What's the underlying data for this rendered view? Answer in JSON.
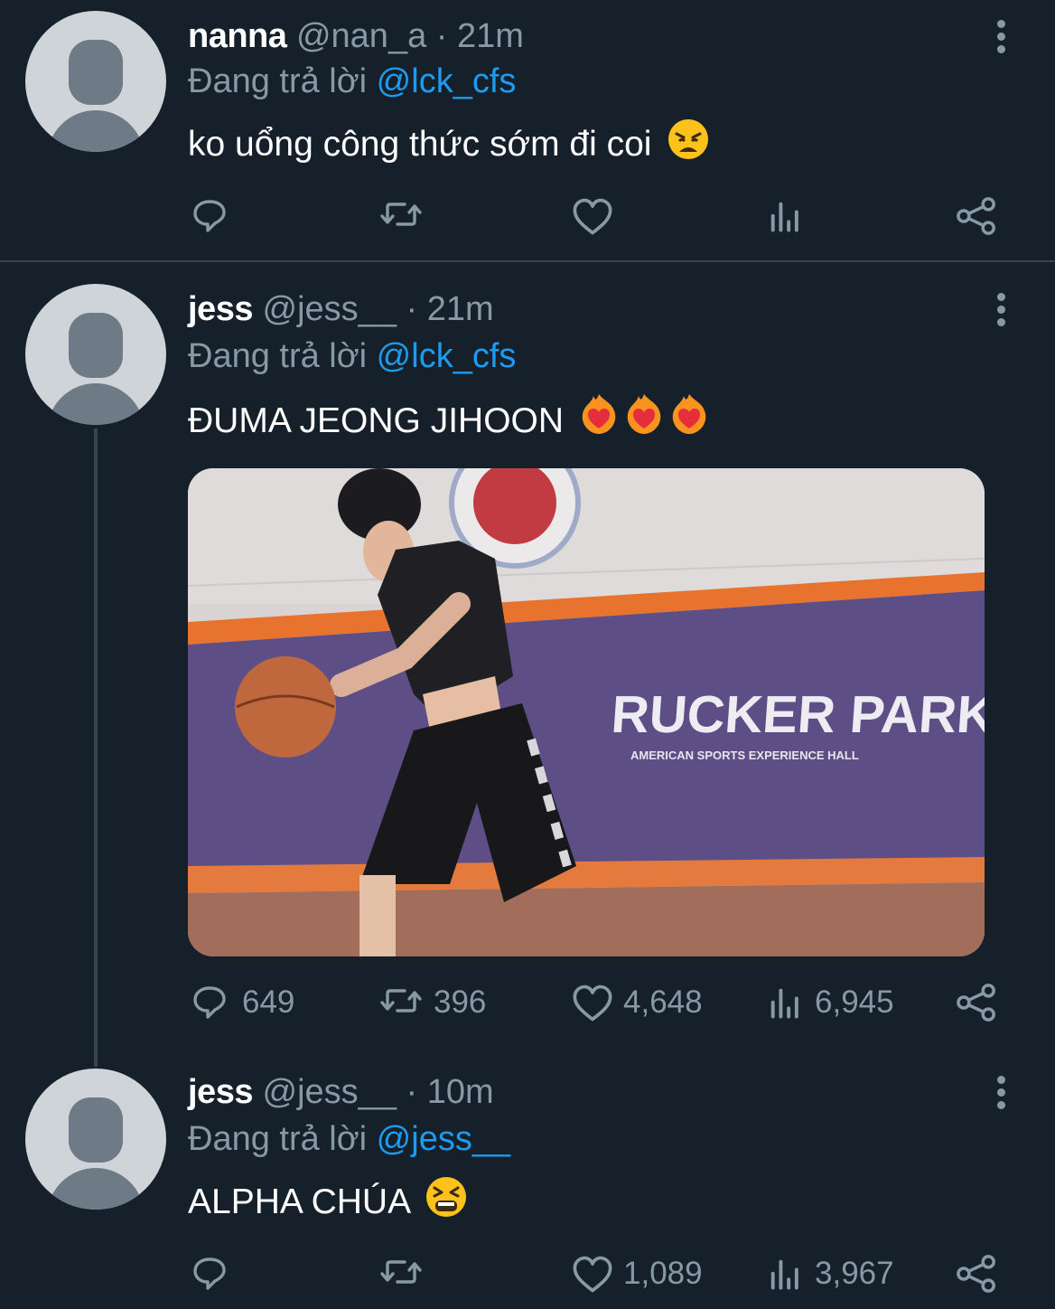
{
  "tweets": [
    {
      "name": "nanna",
      "handle": "@nan_a",
      "dot": "·",
      "time": "21m",
      "reply_prefix": "Đang trả lời",
      "reply_to": "@lck_cfs",
      "text": "ko uổng công thức sớm đi coi",
      "emoji": "weary-face-emoji",
      "stats": {
        "replies": "",
        "retweets": "",
        "likes": "",
        "views": ""
      }
    },
    {
      "name": "jess",
      "handle": "@jess__",
      "dot": "·",
      "time": "21m",
      "reply_prefix": "Đang trả lời",
      "reply_to": "@lck_cfs",
      "text": "ĐUMA JEONG JIHOON",
      "emoji": "heart-on-fire-emoji x3",
      "media": {
        "banner_text": "RUCKER PARK",
        "banner_subtext": "AMERICAN SPORTS EXPERIENCE HALL"
      },
      "stats": {
        "replies": "649",
        "retweets": "396",
        "likes": "4,648",
        "views": "6,945"
      }
    },
    {
      "name": "jess",
      "handle": "@jess__",
      "dot": "·",
      "time": "10m",
      "reply_prefix": "Đang trả lời",
      "reply_to": "@jess__",
      "text": "ALPHA CHÚA",
      "emoji": "tired-face-emoji",
      "stats": {
        "replies": "",
        "retweets": "",
        "likes": "1,089",
        "views": "3,967"
      }
    }
  ],
  "colors": {
    "background": "#15202b",
    "muted": "#8899a6",
    "link": "#1d9bf0",
    "divider": "#38444d"
  }
}
